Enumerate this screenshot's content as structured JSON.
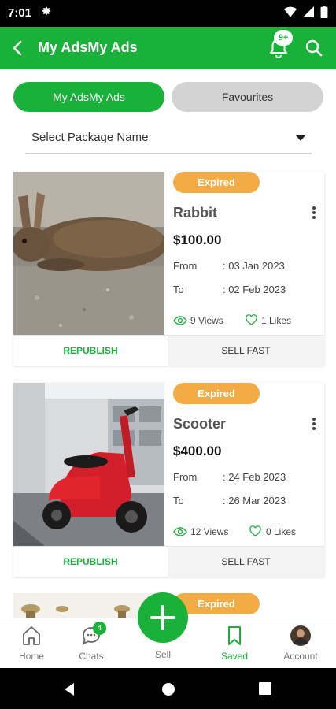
{
  "status": {
    "time": "7:01"
  },
  "header": {
    "title": "My AdsMy Ads",
    "notification_count": "9+"
  },
  "tabs": [
    {
      "label": "My AdsMy Ads"
    },
    {
      "label": "Favourites"
    }
  ],
  "package_select": {
    "placeholder": "Select Package Name"
  },
  "ads": [
    {
      "status": "Expired",
      "name": "Rabbit",
      "price": "$100.00",
      "from_label": "From",
      "from": ": 03 Jan 2023",
      "to_label": "To",
      "to": ": 02 Feb 2023",
      "views": "9 Views",
      "likes": "1 Likes",
      "republish": "REPUBLISH",
      "sell_fast": "SELL FAST"
    },
    {
      "status": "Expired",
      "name": "Scooter",
      "price": "$400.00",
      "from_label": "From",
      "from": ": 24 Feb 2023",
      "to_label": "To",
      "to": ": 26 Mar 2023",
      "views": "12 Views",
      "likes": "0 Likes",
      "republish": "REPUBLISH",
      "sell_fast": "SELL FAST"
    },
    {
      "status": "Expired"
    }
  ],
  "bottom_nav": {
    "home": "Home",
    "chats": "Chats",
    "chats_badge": "4",
    "sell": "Sell",
    "saved": "Saved",
    "account": "Account"
  },
  "colors": {
    "primary": "#19b139",
    "expired": "#f2ab45"
  }
}
